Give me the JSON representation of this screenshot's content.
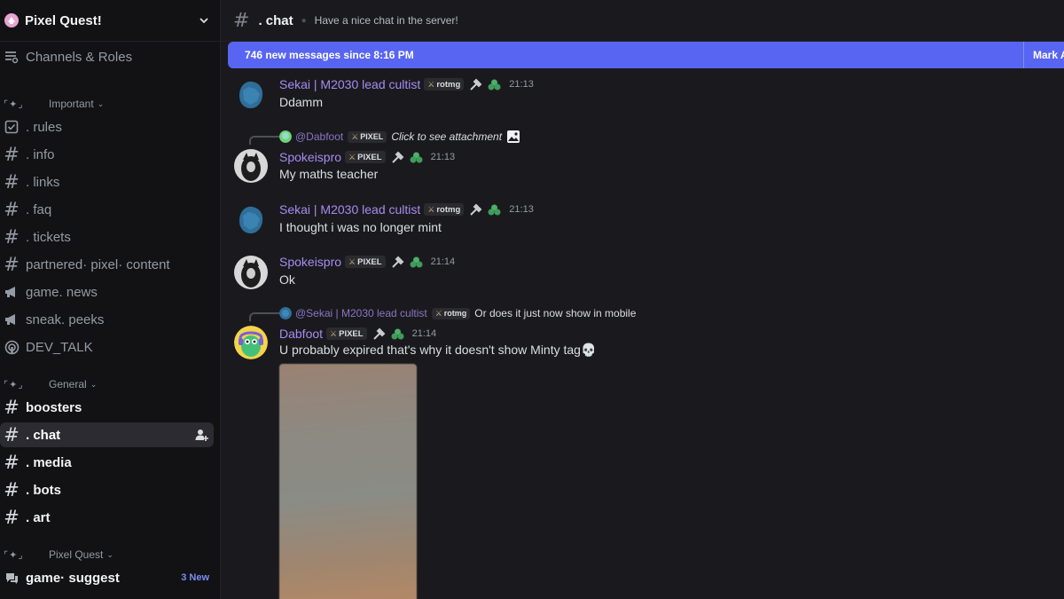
{
  "server": {
    "name": "Pixel Quest!"
  },
  "sidebar": {
    "browse_label": "Channels & Roles",
    "categories": [
      {
        "label": "Important",
        "deco": "⌜✦⌟"
      },
      {
        "label": "General",
        "deco": "⌜✦⌟"
      },
      {
        "label": "Pixel Quest",
        "deco": "⌜✦⌟"
      }
    ],
    "channels": [
      {
        "label": ". rules",
        "icon": "rules-icon"
      },
      {
        "label": ". info",
        "icon": "hash-icon"
      },
      {
        "label": ". links",
        "icon": "hash-icon"
      },
      {
        "label": ". faq",
        "icon": "hash-icon"
      },
      {
        "label": ". tickets",
        "icon": "hash-icon"
      },
      {
        "label": "partnered· pixel· content",
        "icon": "hash-icon"
      },
      {
        "label": "game. news",
        "icon": "announcement-icon"
      },
      {
        "label": "sneak. peeks",
        "icon": "announcement-icon"
      },
      {
        "label": "DEV_TALK",
        "icon": "stage-icon"
      },
      {
        "label": "boosters",
        "icon": "hash-icon"
      },
      {
        "label": ". chat",
        "icon": "hash-icon"
      },
      {
        "label": ". media",
        "icon": "hash-icon"
      },
      {
        "label": ". bots",
        "icon": "hash-icon"
      },
      {
        "label": ". art",
        "icon": "hash-icon"
      },
      {
        "label": "game· suggest",
        "icon": "forum-icon",
        "badge": "3 New"
      }
    ]
  },
  "channel_header": {
    "name": ". chat",
    "topic": "Have a nice chat in the server!"
  },
  "new_messages_bar": {
    "text": "746 new messages since 8:16 PM",
    "action": "Mark As Read"
  },
  "messages": [
    {
      "user": "Sekai | M2030 lead cultist",
      "tag": "rotmg",
      "time": "21:13",
      "text": "Ddamm"
    },
    {
      "reply_user": "@Dabfoot",
      "reply_tag": "PIXEL",
      "reply_text": "Click to see attachment",
      "user": "Spokeispro",
      "tag": "PIXEL",
      "time": "21:13",
      "text": "My maths teacher"
    },
    {
      "user": "Sekai | M2030 lead cultist",
      "tag": "rotmg",
      "time": "21:13",
      "text": "I thought i was no longer mint"
    },
    {
      "user": "Spokeispro",
      "tag": "PIXEL",
      "time": "21:14",
      "text": "Ok"
    },
    {
      "reply_user": "@Sekai | M2030 lead cultist",
      "reply_tag": "rotmg",
      "reply_text": "Or does it just now show in mobile",
      "user": "Dabfoot",
      "tag": "PIXEL",
      "time": "21:14",
      "text": "U probably expired that's why it doesn't show Minty tag💀"
    }
  ],
  "colors": {
    "accent": "#5865f2",
    "username": "#a68cf0",
    "sidebar_bg": "#121214",
    "main_bg": "#1a1a1e"
  }
}
